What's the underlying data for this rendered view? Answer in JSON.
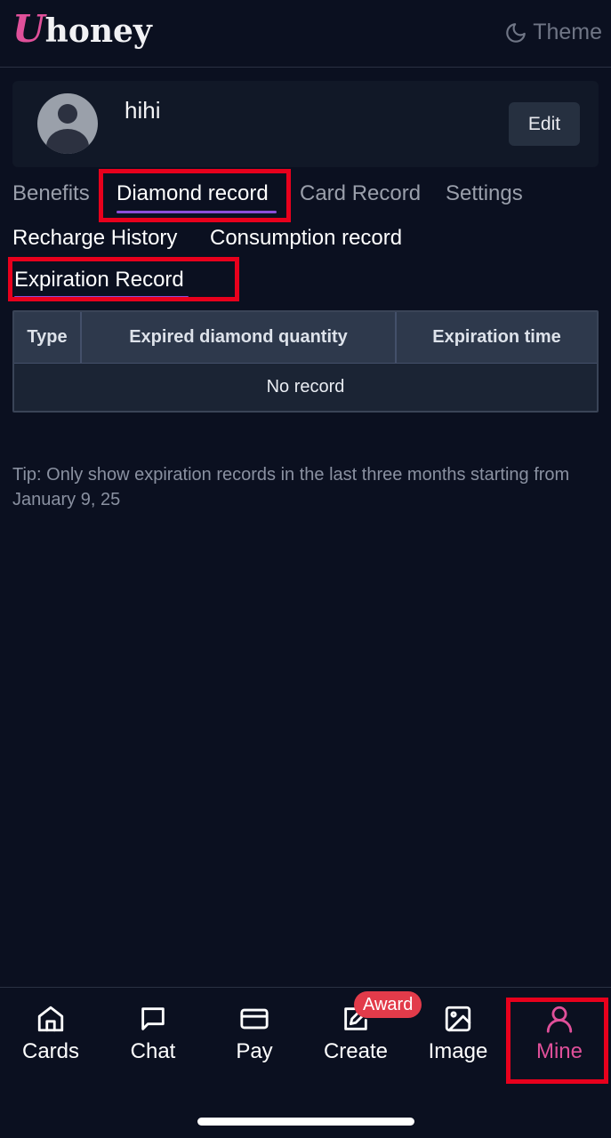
{
  "header": {
    "logo_initial": "U",
    "logo_rest": "honey",
    "theme_label": "Theme"
  },
  "profile": {
    "username": "hihi",
    "edit_label": "Edit"
  },
  "tabs": [
    {
      "label": "Benefits",
      "active": false
    },
    {
      "label": "Diamond record",
      "active": true
    },
    {
      "label": "Card Record",
      "active": false
    },
    {
      "label": "Settings",
      "active": false
    }
  ],
  "subtabs": [
    {
      "label": "Recharge History",
      "active": false
    },
    {
      "label": "Consumption record",
      "active": false
    },
    {
      "label": "Expiration Record",
      "active": true
    }
  ],
  "table": {
    "columns": [
      "Type",
      "Expired diamond quantity",
      "Expiration time"
    ],
    "empty_text": "No record"
  },
  "tip": "Tip: Only show expiration records in the last three months starting from January 9, 25",
  "bottom_nav": {
    "items": [
      {
        "label": "Cards",
        "icon": "home-icon",
        "active": false
      },
      {
        "label": "Chat",
        "icon": "chat-icon",
        "active": false
      },
      {
        "label": "Pay",
        "icon": "card-icon",
        "active": false
      },
      {
        "label": "Create",
        "icon": "edit-icon",
        "active": false
      },
      {
        "label": "Image",
        "icon": "image-icon",
        "active": false
      },
      {
        "label": "Mine",
        "icon": "user-icon",
        "active": true
      }
    ],
    "award_badge": "Award"
  },
  "colors": {
    "background": "#0b1020",
    "accent_pink": "#e0509a",
    "tab_underline": "#8a4fd8",
    "highlight_box": "#e8001c"
  }
}
